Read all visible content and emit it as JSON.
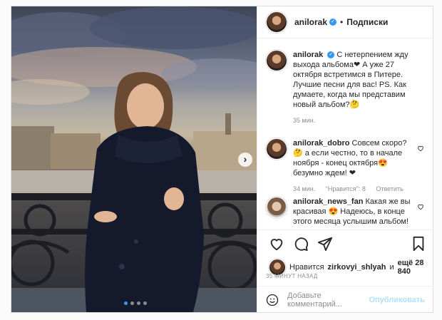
{
  "colors": {
    "link_blue": "#3897f0",
    "muted": "#8e8e8e",
    "border": "#dbdbdb",
    "post_disabled": "#b2dffc"
  },
  "header": {
    "username": "anilorak",
    "follow": "Подписки",
    "separator": "•"
  },
  "photo": {
    "carousel_dots": 4,
    "active_dot": 1,
    "next_icon": "chevron-right-icon"
  },
  "caption": {
    "username": "anilorak",
    "text": "С нетерпением жду выхода альбома❤ А уже 27 октября встретимся в Питере. Лучшие песни для вас! PS. Как думаете, когда мы представим новый альбом?🤔",
    "time": "35 мин."
  },
  "comments": [
    {
      "username": "anilorak_dobro",
      "text": "Совсем скоро? 🤔 а если честно, то в начале ноября - конец октября😍 безумно ждем! ❤",
      "time": "34 мин.",
      "likes": "\"Нравится\": 8",
      "reply": "Ответить"
    },
    {
      "username": "anilorak_news_fan",
      "text": "Какая же вы красивая 😍 Надеюсь, в конце этого месяца услышим альбом!"
    }
  ],
  "actions": {
    "icons": [
      "heart-icon",
      "comment-icon",
      "share-icon",
      "bookmark-icon"
    ]
  },
  "likes": {
    "prefix": "Нравится",
    "user": "zirkovyi_shlyah",
    "conj": "и",
    "rest": "ещё 28 840"
  },
  "timestamp": "35 МИНУТ НАЗАД",
  "comment_box": {
    "placeholder": "Добавьте комментарий...",
    "post": "Опубликовать",
    "emoji_icon": "smiley-icon"
  }
}
